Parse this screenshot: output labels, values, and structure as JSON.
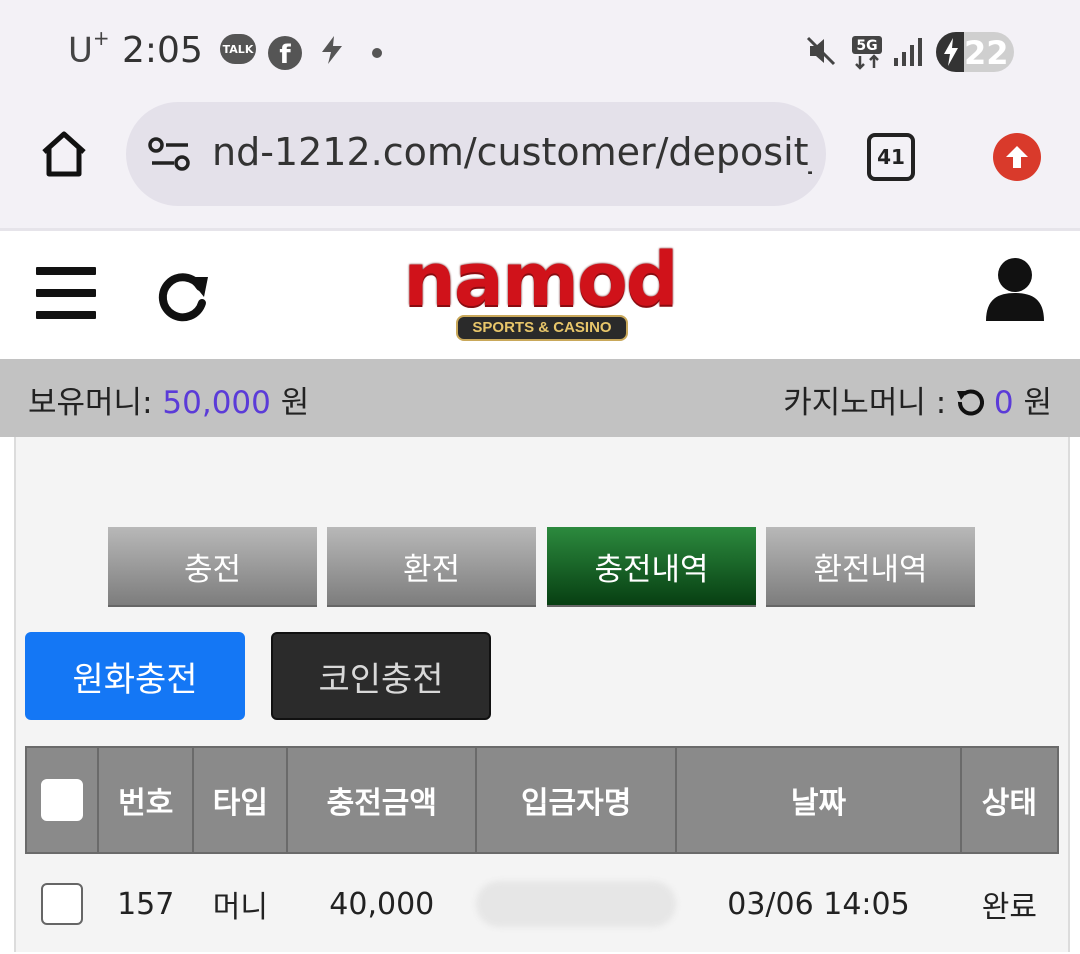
{
  "status_bar": {
    "carrier": "U",
    "carrier_sup": "+",
    "time": "2:05",
    "talk_badge": "TALK",
    "network": "5G",
    "battery": "22"
  },
  "browser": {
    "url": "nd-1212.com/customer/deposit_",
    "tab_count": "41"
  },
  "site": {
    "logo_text": "namod",
    "logo_subtext": "SPORTS & CASINO"
  },
  "money": {
    "holding_label": "보유머니: ",
    "holding_value": "50,000",
    "holding_unit": " 원",
    "casino_label": "카지노머니 : ",
    "casino_value": "0",
    "casino_unit": " 원"
  },
  "tabs": [
    {
      "label": "충전"
    },
    {
      "label": "환전"
    },
    {
      "label": "충전내역"
    },
    {
      "label": "환전내역"
    }
  ],
  "sub_buttons": {
    "krw": "원화충전",
    "coin": "코인충전"
  },
  "table": {
    "headers": [
      "번호",
      "타입",
      "충전금액",
      "입금자명",
      "날짜",
      "상태"
    ],
    "rows": [
      {
        "no": "157",
        "type": "머니",
        "amount": "40,000",
        "date": "03/06 14:05",
        "status": "완료"
      }
    ]
  },
  "colors": {
    "active_tab": "#1f6b2e",
    "primary_button": "#1477f5",
    "money_value": "#5b3bd8",
    "logo_red": "#d0121a"
  }
}
